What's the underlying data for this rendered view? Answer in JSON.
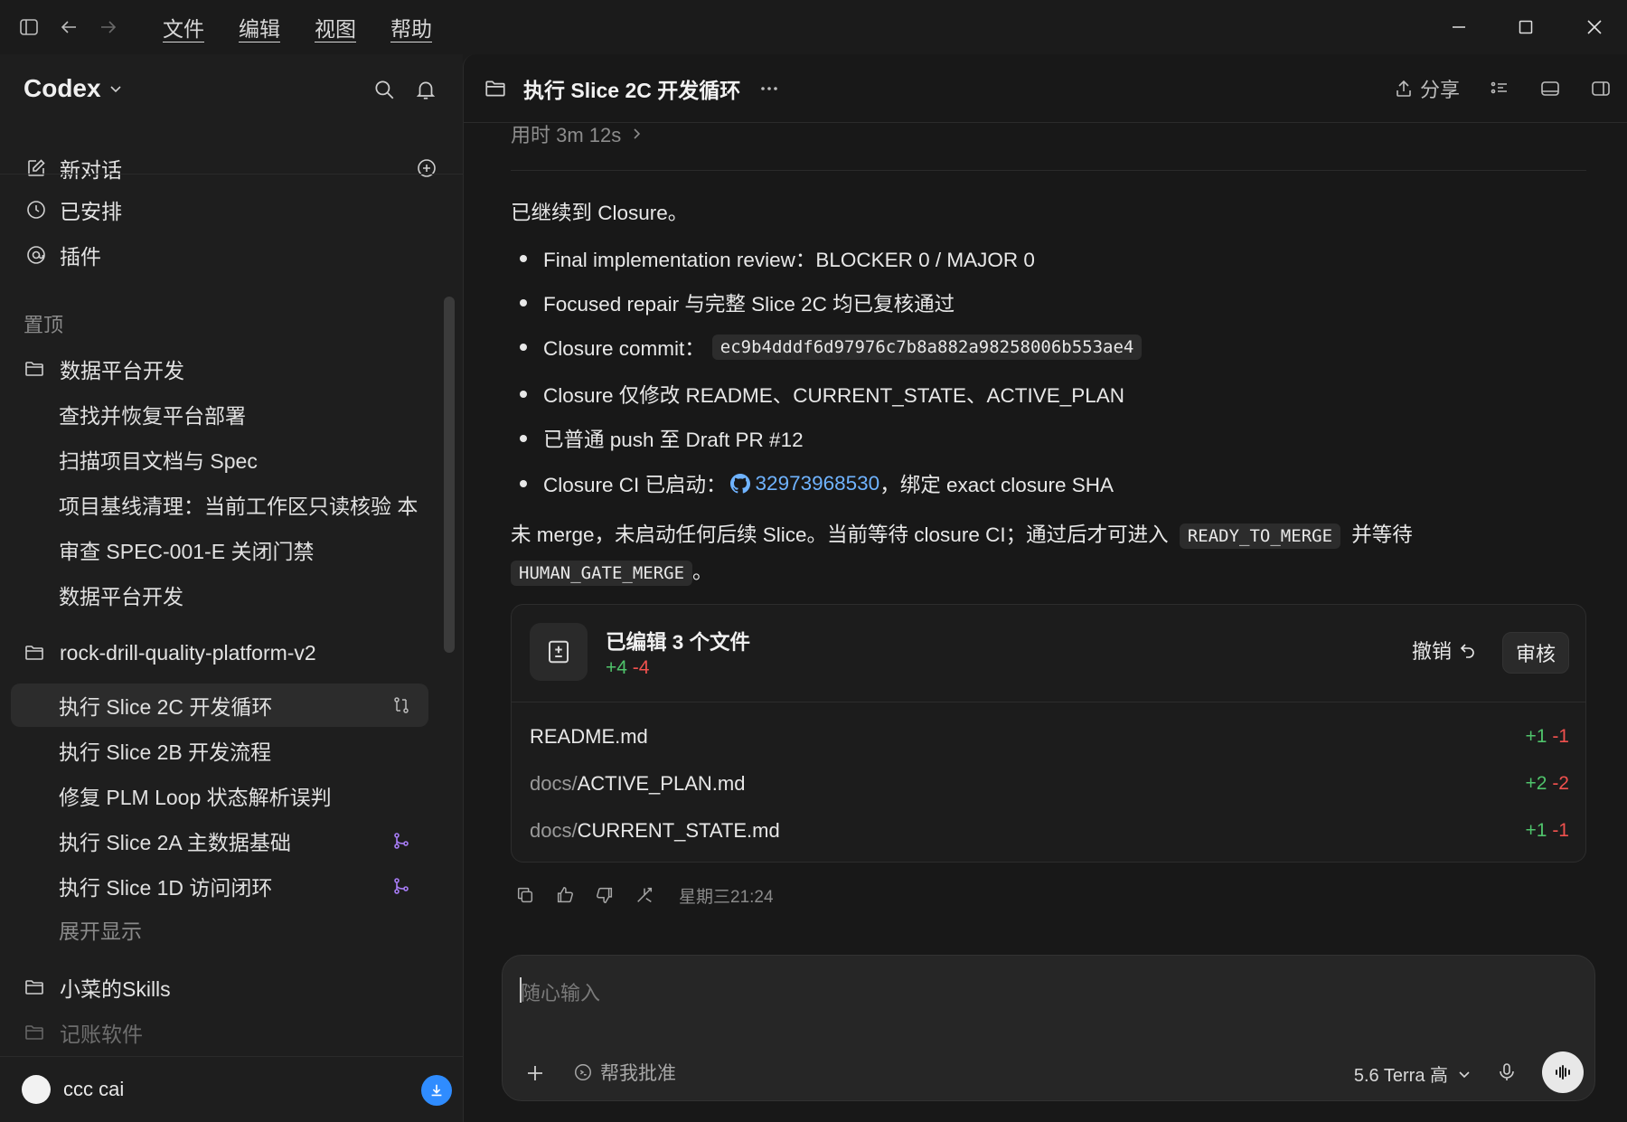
{
  "menu": {
    "file": "文件",
    "edit": "编辑",
    "view": "视图",
    "help": "帮助"
  },
  "sidebar": {
    "app_title": "Codex",
    "new_chat": "新对话",
    "scheduled": "已安排",
    "plugins": "插件",
    "pinned_label": "置顶",
    "projects": [
      {
        "name": "数据平台开发",
        "threads": [
          "查找并恢复平台部署",
          "扫描项目文档与 Spec",
          "项目基线清理：当前工作区只读核验 本",
          "审查 SPEC-001-E 关闭门禁",
          "数据平台开发"
        ]
      },
      {
        "name": "rock-drill-quality-platform-v2",
        "threads": [
          "执行 Slice 2C 开发循环",
          "执行 Slice 2B 开发流程",
          "修复 PLM Loop 状态解析误判",
          "执行 Slice 2A 主数据基础",
          "执行 Slice 1D 访问闭环"
        ],
        "show_more": "展开显示"
      },
      {
        "name": "小菜的Skills"
      },
      {
        "name": "记账软件"
      }
    ],
    "user_name": "ccc cai"
  },
  "conversation": {
    "title": "执行 Slice 2C 开发循环",
    "share": "分享",
    "duration": "用时 3m 12s",
    "intro": "已继续到 Closure。",
    "bullets": {
      "b1": "Final implementation review：BLOCKER 0 / MAJOR 0",
      "b2": "Focused repair 与完整 Slice 2C 均已复核通过",
      "b3_label": "Closure commit：",
      "b3_code": "ec9b4dddf6d97976c7b8a882a98258006b553ae4",
      "b4": "Closure 仅修改 README、CURRENT_STATE、ACTIVE_PLAN",
      "b5": "已普通 push 至 Draft PR #12",
      "b6_label": "Closure CI 已启动：",
      "b6_link": "32973968530",
      "b6_tail": "，绑定 exact closure SHA"
    },
    "summary": {
      "part1": "未 merge，未启动任何后续 Slice。当前等待 closure CI；通过后才可进入",
      "code1": "READY_TO_MERGE",
      "part2": "并等待",
      "code2": "HUMAN_GATE_MERGE",
      "part3": "。"
    },
    "edits": {
      "title": "已编辑 3 个文件",
      "add": "+4",
      "del": "-4",
      "undo": "撤销",
      "review": "审核",
      "files": [
        {
          "dir": "",
          "name": "README.md",
          "add": "+1",
          "del": "-1"
        },
        {
          "dir": "docs/",
          "name": "ACTIVE_PLAN.md",
          "add": "+2",
          "del": "-2"
        },
        {
          "dir": "docs/",
          "name": "CURRENT_STATE.md",
          "add": "+1",
          "del": "-1"
        }
      ]
    },
    "timestamp": "星期三21:24"
  },
  "composer": {
    "placeholder": "随心输入",
    "approve": "帮我批准",
    "model": "5.6 Terra 高"
  }
}
